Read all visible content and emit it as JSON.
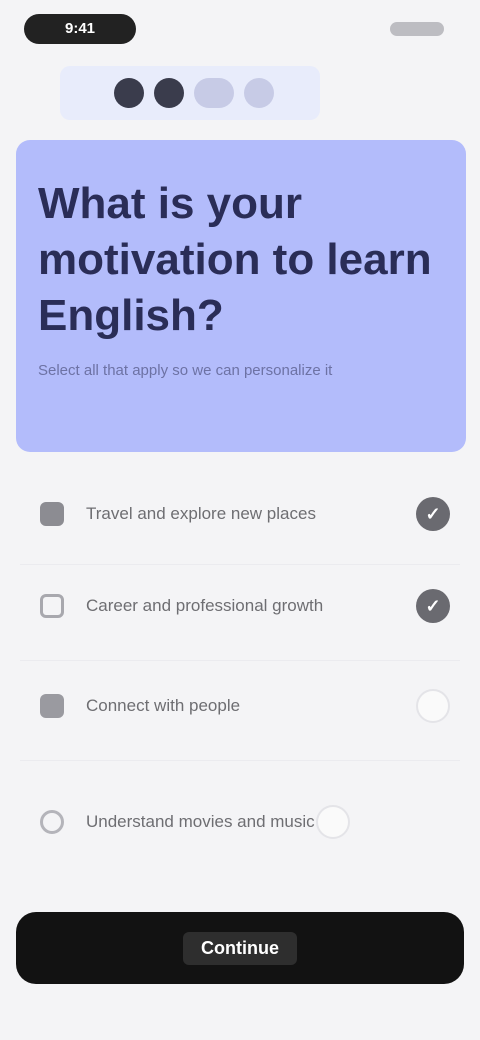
{
  "status_bar": {
    "time": "9:41",
    "icons": "status-icons"
  },
  "progress": {
    "steps_total": 4,
    "steps_done": 2,
    "colors": {
      "done": "#3a3c4c",
      "current": "#43465c",
      "pending": "#c7cbe6"
    }
  },
  "header": {
    "title": "What is your motivation to learn English?",
    "subtitle": "Select all that apply so we can personalize it",
    "background": "#b3bcfb"
  },
  "options": [
    {
      "label": "Travel and explore new places",
      "icon": "globe-icon",
      "selected": true
    },
    {
      "label": "Career and professional growth",
      "icon": "briefcase-icon",
      "selected": true
    },
    {
      "label": "Connect with people",
      "icon": "people-icon",
      "selected": false
    },
    {
      "label": "Understand movies and music",
      "icon": "music-icon",
      "selected": false
    }
  ],
  "actions": {
    "continue_label": "Continue"
  },
  "colors": {
    "accent": "#b3bcfb",
    "button": "#121212",
    "check_on": "#6a6a70"
  }
}
